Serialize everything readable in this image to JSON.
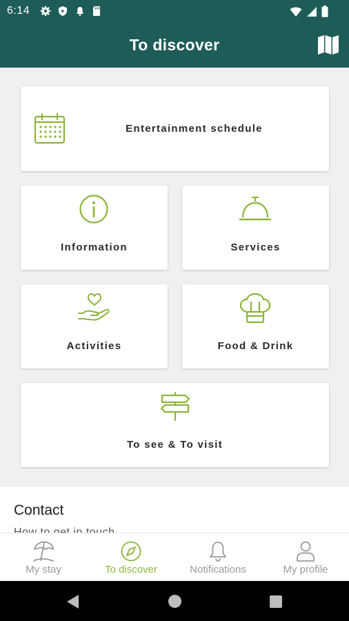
{
  "status_bar": {
    "time": "6:14"
  },
  "app_bar": {
    "title": "To discover"
  },
  "tiles": {
    "entertainment": "Entertainment schedule",
    "information": "Information",
    "services": "Services",
    "activities": "Activities",
    "food_drink": "Food & Drink",
    "to_see": "To see & To visit"
  },
  "contact": {
    "title": "Contact",
    "subtitle": "How to get in touch"
  },
  "bottom_nav": {
    "my_stay": "My stay",
    "to_discover": "To discover",
    "notifications": "Notifications",
    "my_profile": "My profile"
  },
  "colors": {
    "header": "#1e5c58",
    "accent": "#8cb53a",
    "inactive": "#999999"
  }
}
